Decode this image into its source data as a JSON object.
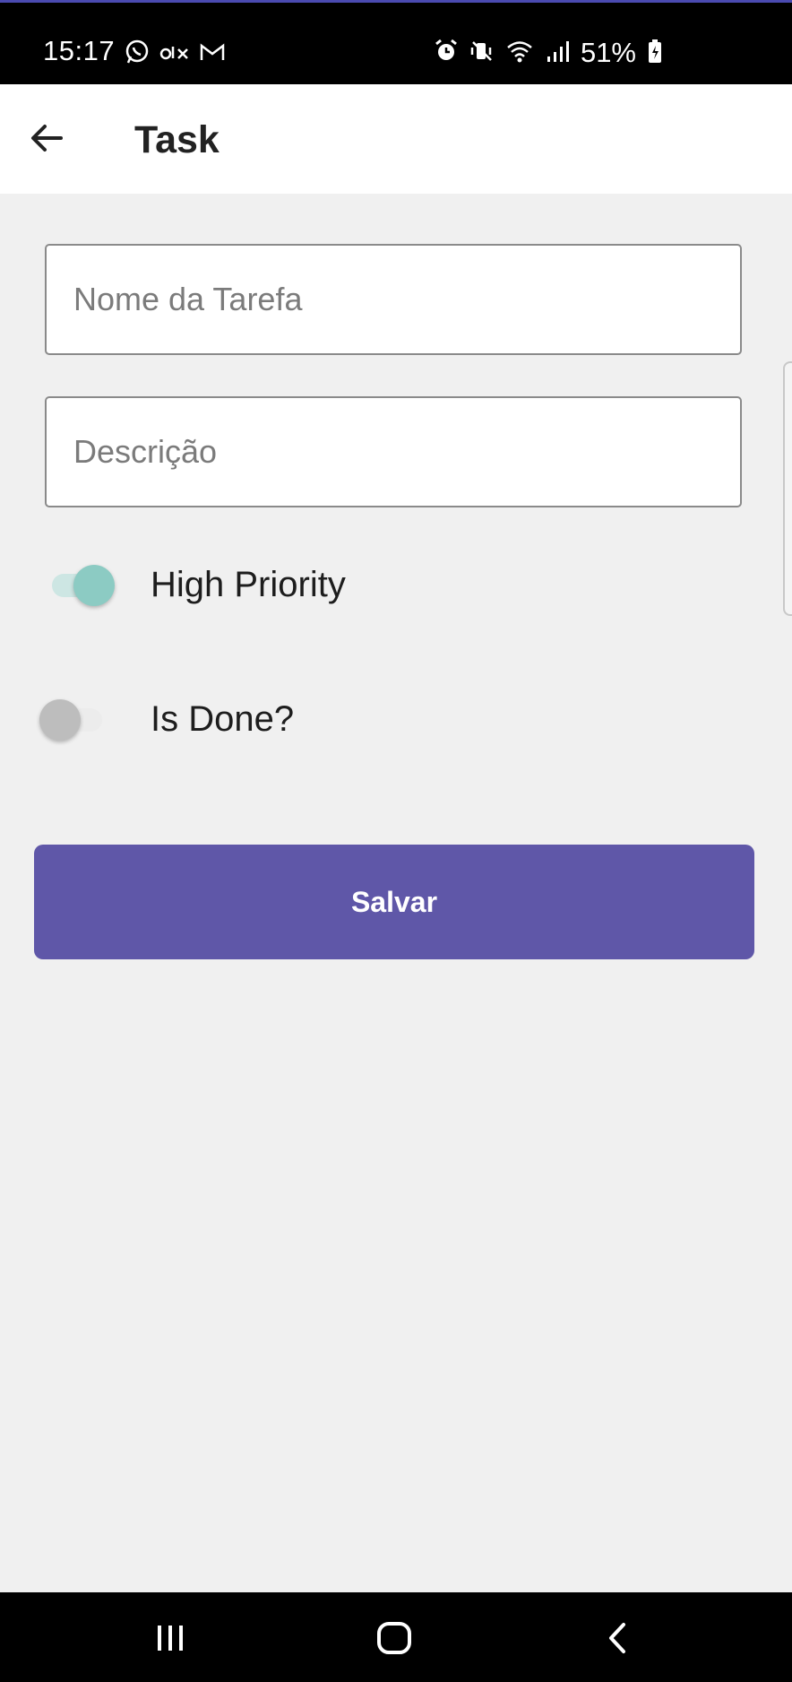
{
  "status_bar": {
    "time": "15:17",
    "left_icons": [
      "whatsapp-icon",
      "olx-icon",
      "gmail-icon"
    ],
    "right_icons": [
      "alarm-icon",
      "vibrate-mute-icon",
      "wifi-icon",
      "signal-icon"
    ],
    "battery": "51%"
  },
  "app_bar": {
    "back_icon": "arrow-left-icon",
    "title": "Task"
  },
  "form": {
    "name_placeholder": "Nome da Tarefa",
    "description_placeholder": "Descrição",
    "high_priority": {
      "label": "High Priority",
      "checked": true
    },
    "is_done": {
      "label": "Is Done?",
      "checked": false
    },
    "save_label": "Salvar"
  },
  "colors": {
    "primary": "#5f57a8",
    "switch_on": "#8ccbc3",
    "switch_off": "#bdbdbd",
    "background": "#f0f0f0"
  },
  "nav_bar": {
    "icons": [
      "recents-icon",
      "home-icon",
      "back-icon"
    ]
  }
}
